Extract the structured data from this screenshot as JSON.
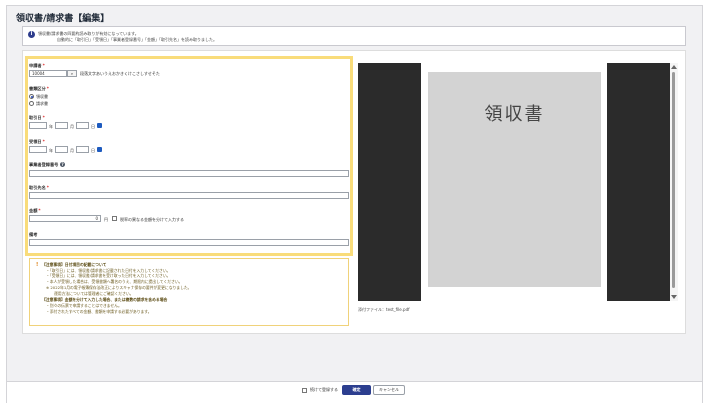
{
  "header": {
    "title": "領収書/請求書【編集】"
  },
  "notice": {
    "line1": "領収書/請求書の四要約読み取りが有効になっています。",
    "line2": "自動的に「取引日」「受領日」「事業者登録番号」「金額」「取引先名」を読み取りました。"
  },
  "form": {
    "applicant": {
      "label": "申請者",
      "value": "10004",
      "hint": "段落文字あいうえおかきくけこさしすせそた"
    },
    "document_type": {
      "label": "書類区分",
      "options": [
        "領収書",
        "請求書"
      ],
      "selected": "領収書"
    },
    "transaction_date": {
      "label": "取引日",
      "year": "年",
      "month": "月",
      "day": "日"
    },
    "receipt_date": {
      "label": "受領日",
      "year": "年",
      "month": "月",
      "day": "日"
    },
    "registration_number": {
      "label": "事業者登録番号"
    },
    "partner_name": {
      "label": "取引先名"
    },
    "amount": {
      "label": "金額",
      "value": "0",
      "unit": "円",
      "tax_option": "税率の異なる金額を分けて入力する"
    },
    "remarks": {
      "label": "備考"
    },
    "required_mark": "*"
  },
  "notes": [
    "【注意事項】日付項目の記載について",
    "・「取引日」には、領収書/請求書に記載された日付を入力してください。",
    "・「受領日」には、領収書/請求書を受け取った日付を入力してください。",
    "・本人が受領した場合は、受領書類へ署名のうえ、期限内に提出してください。",
    "※ 2022年1月の電子帳簿保存法改正によりスキャナ保存の要件が変更になりました。",
    "運用方法については管理者にご確認ください。",
    "【注意事項】金額を分けて入力した場合、または複数の請求を含める場合",
    "・別々の伝票で申請することはできません。",
    "・添付されたすべての金額、書類を申請する必要があります。"
  ],
  "preview": {
    "receipt_text": "領収書",
    "attachment_label": "添付ファイル：test_file.pdf"
  },
  "footer": {
    "continue_label": "続けて登録する",
    "confirm_label": "確定",
    "cancel_label": "キャンセル"
  }
}
